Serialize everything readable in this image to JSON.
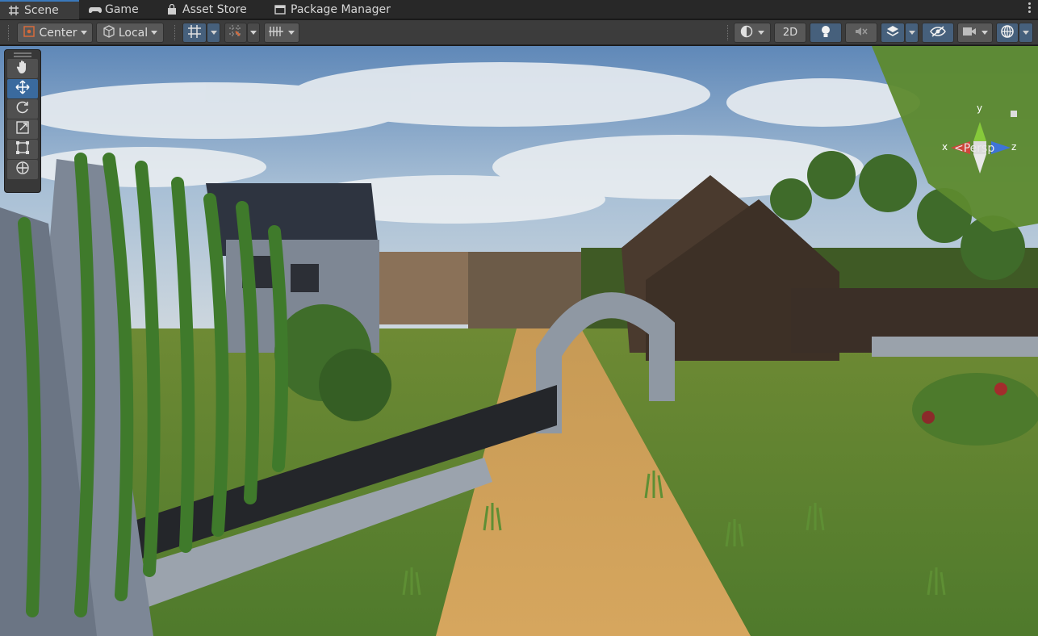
{
  "tabs": [
    {
      "label": "Scene",
      "icon": "grid-icon",
      "active": true
    },
    {
      "label": "Game",
      "icon": "gamepad-icon",
      "active": false
    },
    {
      "label": "Asset Store",
      "icon": "store-bag-icon",
      "active": false
    },
    {
      "label": "Package Manager",
      "icon": "package-icon",
      "active": false
    }
  ],
  "toolbar": {
    "pivot_mode": "Center",
    "pivot_rotation": "Local",
    "toggle_2d": "2D"
  },
  "gizmo": {
    "x_label": "x",
    "y_label": "y",
    "z_label": "z",
    "projection": "<Persp"
  },
  "colors": {
    "accent": "#3a79bb",
    "active_tool": "#3a6a9e",
    "toolbar_bg": "#3c3c3c",
    "tabbar_bg": "#282828"
  }
}
